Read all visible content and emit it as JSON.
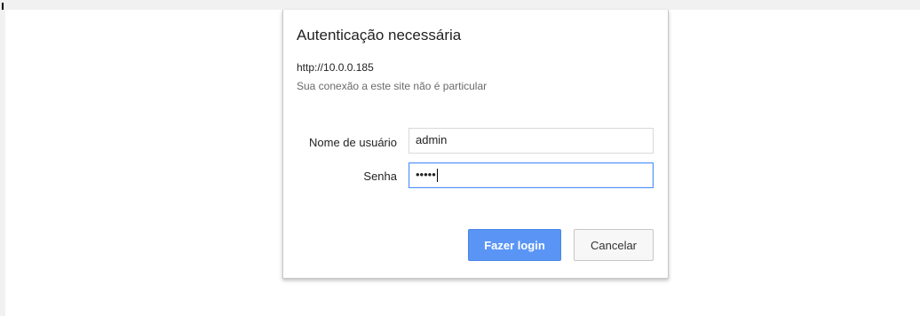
{
  "dialog": {
    "title": "Autenticação necessária",
    "origin": "http://10.0.0.185",
    "warning": "Sua conexão a este site não é particular",
    "username_label": "Nome de usuário",
    "username_value": "admin",
    "password_label": "Senha",
    "password_masked": "•••••",
    "login_button": "Fazer login",
    "cancel_button": "Cancelar"
  },
  "colors": {
    "accent": "#5a95f5",
    "focus_border": "#4d90fe"
  }
}
